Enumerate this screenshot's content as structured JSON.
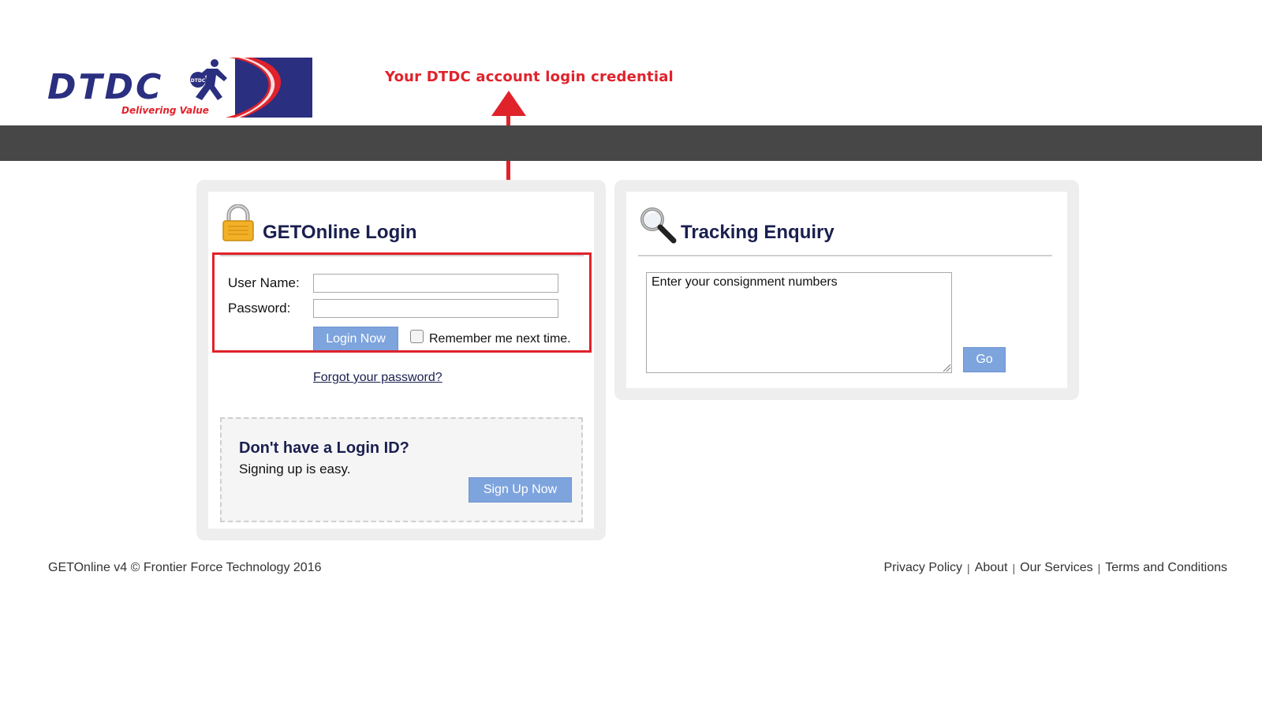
{
  "header": {
    "logo_main": "DTDC",
    "logo_tagline": "Delivering Value",
    "logo_badge": "DTDC",
    "annotation": "Your DTDC account login credential"
  },
  "login_panel": {
    "title": "GETOnline Login",
    "username_label": "User Name:",
    "username_value": "",
    "password_label": "Password:",
    "password_value": "",
    "login_button": "Login Now",
    "remember_checked": false,
    "remember_label": "Remember me next time.",
    "forgot_link": "Forgot your password?",
    "signup": {
      "title": "Don't have a Login ID?",
      "subtitle": "Signing up is easy.",
      "button": "Sign Up Now"
    }
  },
  "tracking_panel": {
    "title": "Tracking Enquiry",
    "consignment_value": "Enter your consignment numbers",
    "go_button": "Go"
  },
  "footer": {
    "copyright": "GETOnline v4 © Frontier Force Technology 2016",
    "links": [
      "Privacy Policy",
      "About",
      "Our Services",
      "Terms and Conditions"
    ]
  },
  "colors": {
    "brand_navy": "#2b2f80",
    "brand_red": "#e0222b",
    "topbar": "#474747",
    "button_blue": "#7ea4dd",
    "title_navy": "#1a1f4f"
  },
  "icons": {
    "login": "lock-icon",
    "tracking": "magnifier-icon"
  }
}
